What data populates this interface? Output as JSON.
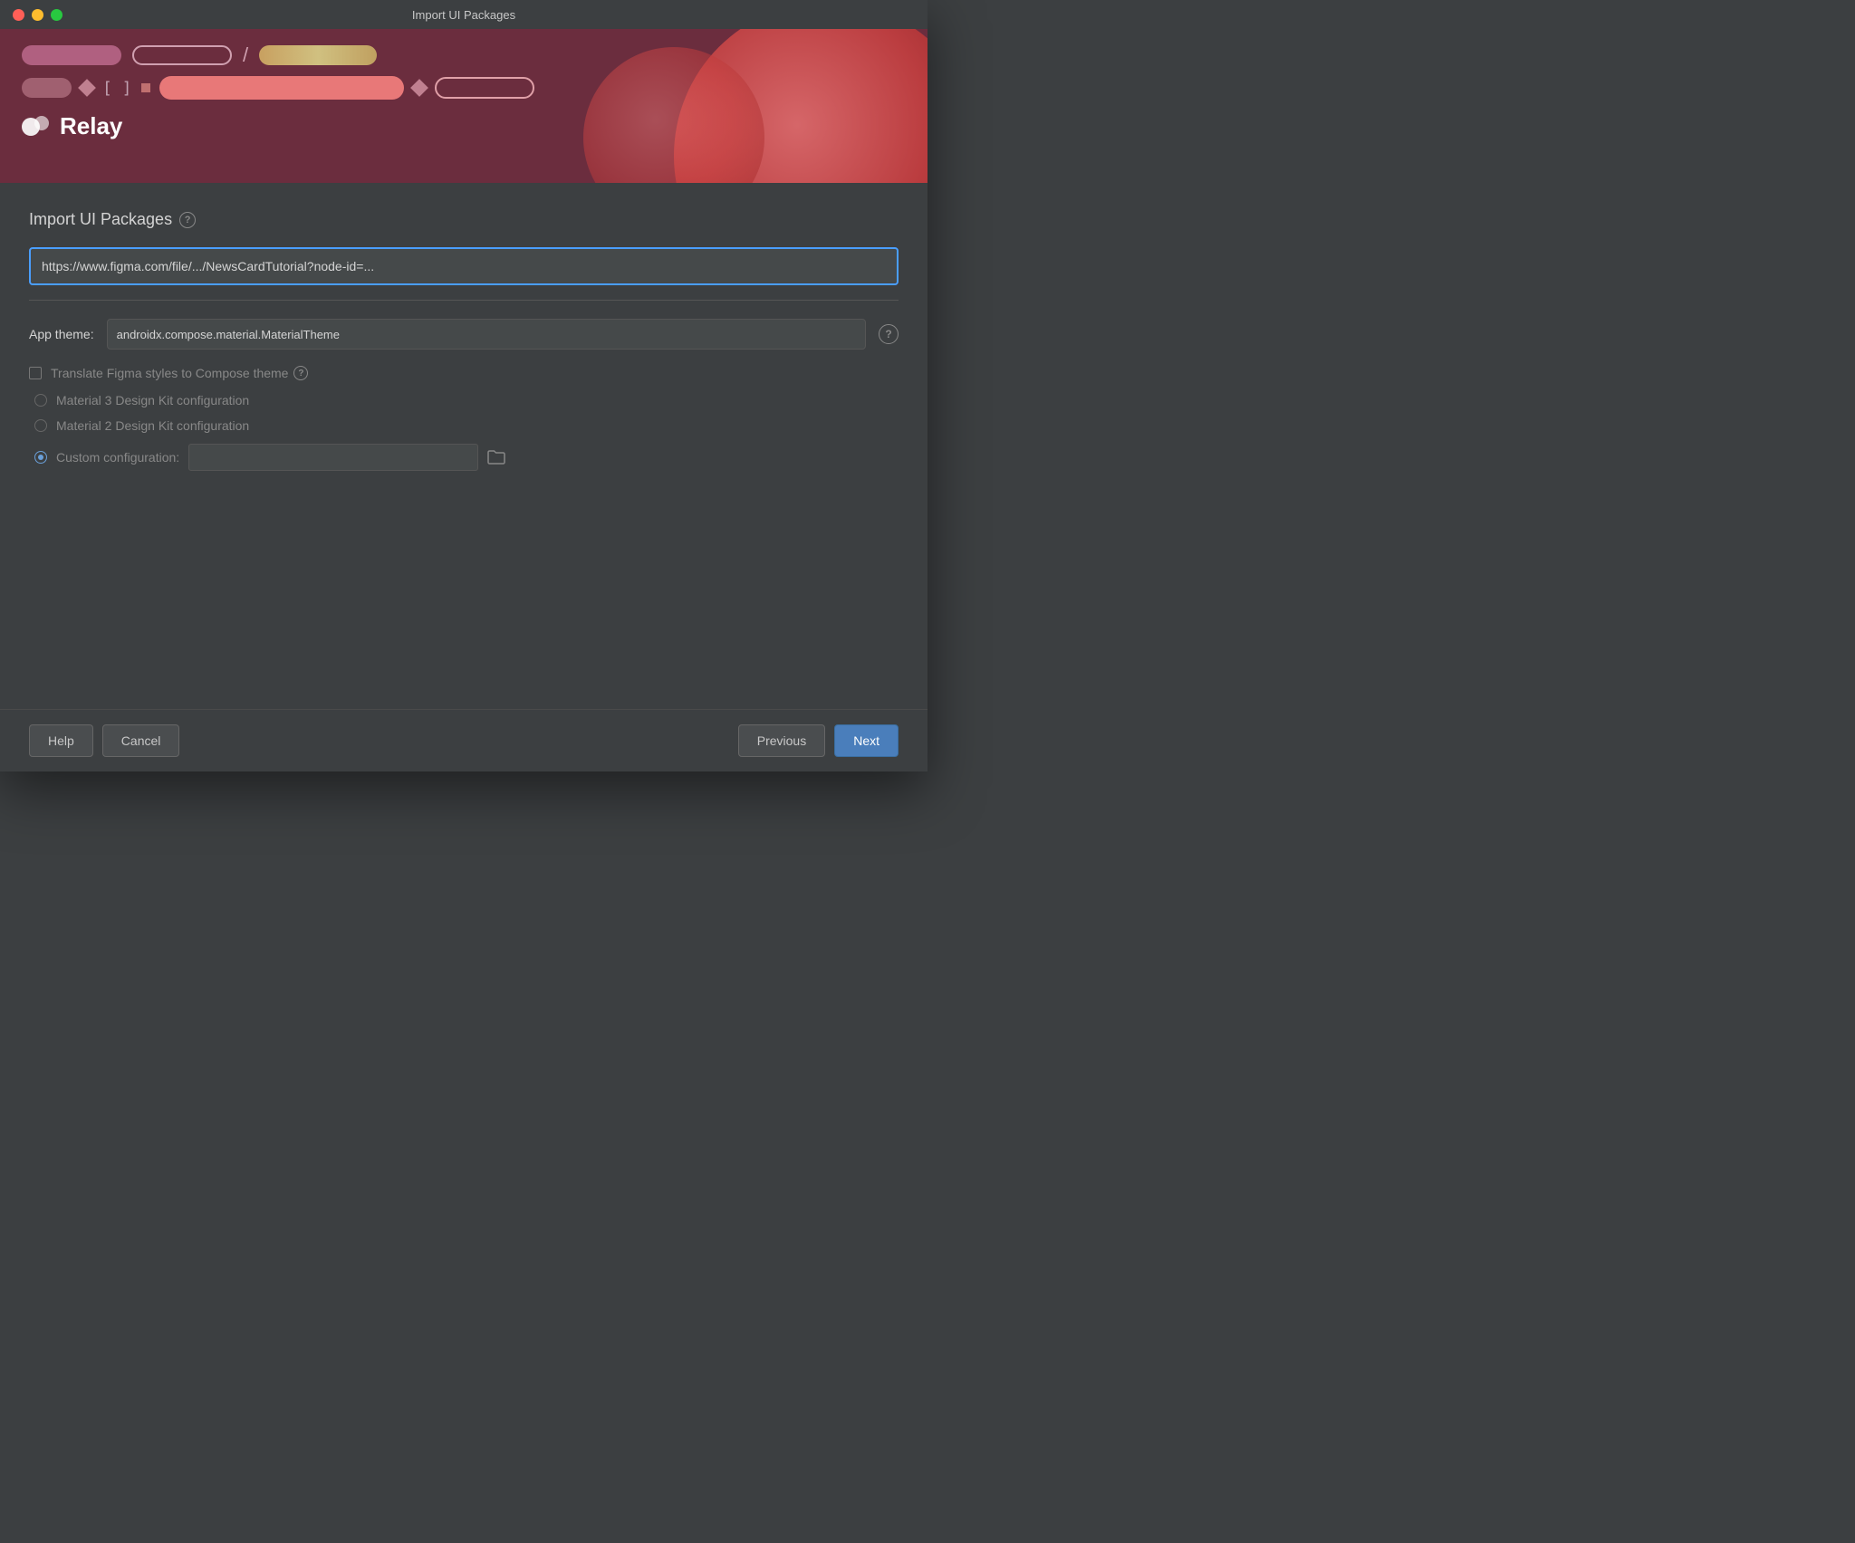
{
  "window": {
    "title": "Import UI Packages"
  },
  "hero": {
    "logo_text": "Relay"
  },
  "main": {
    "section_title": "Import UI Packages",
    "help_icon_label": "?",
    "url_input": {
      "value": "https://www.figma.com/file/.../NewsCardTutorial?node-id=...",
      "placeholder": "https://www.figma.com/file/.../NewsCardTutorial?node-id=..."
    },
    "app_theme_label": "App theme:",
    "app_theme_value": "androidx.compose.material.MaterialTheme",
    "translate_label": "Translate Figma styles to Compose theme",
    "translate_help": "?",
    "radio_options": [
      {
        "label": "Material 3 Design Kit configuration",
        "checked": false
      },
      {
        "label": "Material 2 Design Kit configuration",
        "checked": false
      }
    ],
    "custom_config_label": "Custom configuration:",
    "custom_config_value": ""
  },
  "footer": {
    "help_label": "Help",
    "cancel_label": "Cancel",
    "previous_label": "Previous",
    "next_label": "Next"
  }
}
